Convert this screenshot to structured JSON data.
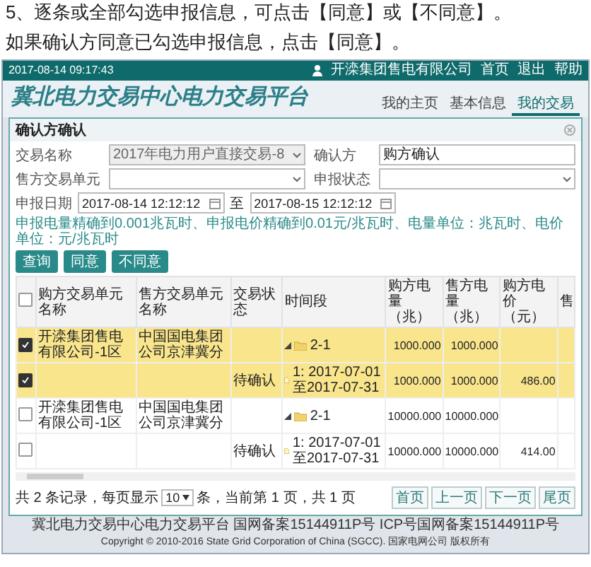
{
  "instructions": [
    "5、逐条或全部勾选申报信息，可点击【同意】或【不同意】。",
    "如果确认方同意已勾选申报信息，点击【同意】。"
  ],
  "top_bar": {
    "datetime": "2017-08-14 09:17:43",
    "user": "开滦集团售电有限公司",
    "links": [
      "首页",
      "退出",
      "帮助"
    ]
  },
  "site_title": "冀北电力交易中心电力交易平台",
  "nav": [
    {
      "label": "我的主页",
      "selected": false
    },
    {
      "label": "基本信息",
      "selected": false
    },
    {
      "label": "我的交易",
      "selected": true
    }
  ],
  "dialog": {
    "title": "确认方确认",
    "fields": [
      {
        "label": "交易名称",
        "kind": "select",
        "value": "2017年电力用户直接交易-8",
        "disabled": true
      },
      {
        "label": "确认方",
        "kind": "text",
        "value": "购方确认",
        "disabled": false
      },
      {
        "label": "售方交易单元",
        "kind": "select",
        "disabled": false
      },
      {
        "label": "申报状态",
        "kind": "select",
        "disabled": false
      }
    ],
    "date_range": {
      "label": "申报日期",
      "from": "2017-08-14 12:12:12",
      "separator": "至",
      "to": "2017-08-15 12:12:12"
    },
    "note": "申报电量精确到0.001兆瓦时、申报电价精确到0.01元/兆瓦时、电量单位：兆瓦时、电价单位：元/兆瓦时",
    "buttons": [
      "查询",
      "同意",
      "不同意"
    ],
    "table": {
      "all_checked": false,
      "columns": [
        "购方交易单元名称",
        "售方交易单元名称",
        "交易状态",
        "时间段",
        "购方电量（兆）",
        "售方电量（兆）",
        "购方电价（元）",
        "售"
      ],
      "rows": [
        {
          "checked": true,
          "selected": true,
          "expanded": true,
          "buyer": "开滦集团售电有限公司-1区",
          "seller": "中国国电集团公司京津冀分",
          "status": "",
          "period": "2-1",
          "buyer_volume": "1000.000",
          "seller_volume": "1000.000",
          "buyer_price": "",
          "children": [
            {
              "checked": true,
              "selected": true,
              "status": "待确认",
              "period": "1: 2017-07-01至2017-07-31",
              "buyer_volume": "1000.000",
              "seller_volume": "1000.000",
              "buyer_price": "486.00"
            }
          ]
        },
        {
          "checked": false,
          "selected": false,
          "expanded": true,
          "buyer": "开滦集团售电有限公司-1区",
          "seller": "中国国电集团公司京津冀分",
          "status": "",
          "period": "2-1",
          "buyer_volume": "10000.000",
          "seller_volume": "10000.000",
          "buyer_price": "",
          "children": [
            {
              "checked": false,
              "selected": false,
              "status": "待确认",
              "period": "1: 2017-07-01至2017-07-31",
              "buyer_volume": "10000.000",
              "seller_volume": "10000.000",
              "buyer_price": "414.00"
            }
          ]
        }
      ]
    },
    "pagination": {
      "summary_before": "共 2 条记录，每页显示",
      "page_size": "10",
      "summary_after": "条，当前第 1 页，共 1 页",
      "buttons": [
        "首页",
        "上一页",
        "下一页",
        "尾页"
      ]
    }
  },
  "footer": {
    "site": "冀北电力交易中心电力交易平台",
    "icp": "国网备案15144911P号 ICP号国网备案15144911P号",
    "copyright": "Copyright © 2010-2016 State Grid Corporation of China (SGCC). 国家电网公司 版权所有"
  }
}
